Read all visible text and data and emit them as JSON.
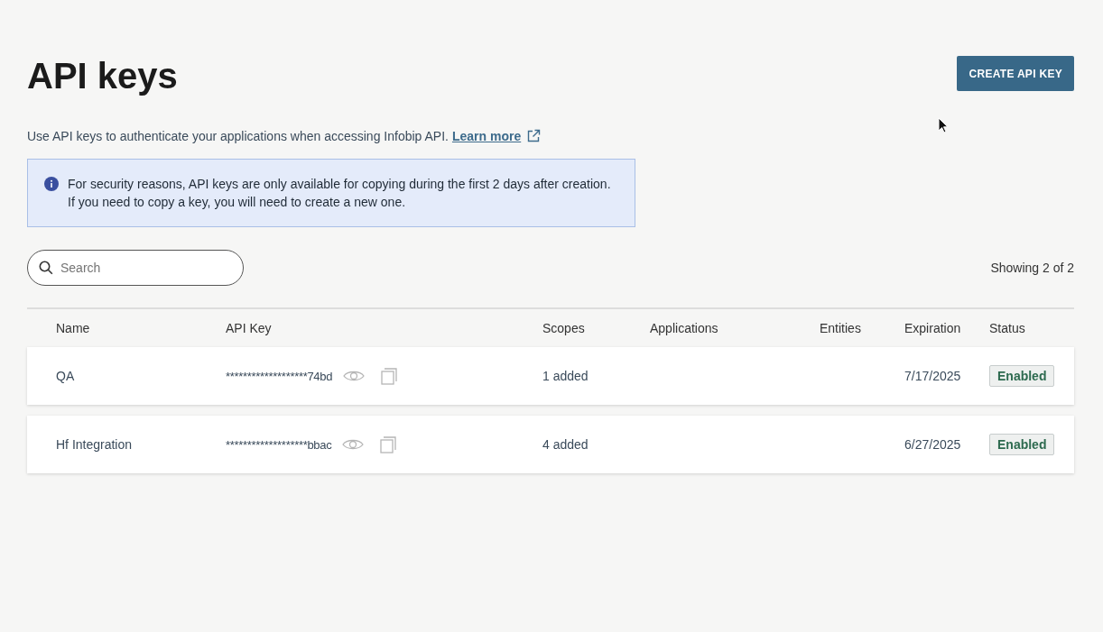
{
  "page": {
    "title": "API keys",
    "create_button": "CREATE API KEY",
    "description": "Use API keys to authenticate your applications when accessing Infobip API.",
    "learn_more": "Learn more"
  },
  "notice": {
    "text": "For security reasons, API keys are only available for copying during the first 2 days after creation. If you need to copy a key, you will need to create a new one."
  },
  "search": {
    "placeholder": "Search"
  },
  "count": "Showing 2 of 2",
  "table": {
    "columns": [
      "Name",
      "API Key",
      "Scopes",
      "Applications",
      "Entities",
      "Expiration",
      "Status"
    ],
    "rows": [
      {
        "name": "QA",
        "api_key": "*******************74bd",
        "scopes": "1 added",
        "expiration": "7/17/2025",
        "status": {
          "label": "Enabled",
          "kind": "enabled"
        }
      },
      {
        "name": "Hf Integration",
        "api_key": "*******************bbac",
        "scopes": "4 added",
        "expiration": "6/27/2025",
        "status": {
          "label": "Enabled",
          "kind": "enabled"
        }
      }
    ]
  }
}
